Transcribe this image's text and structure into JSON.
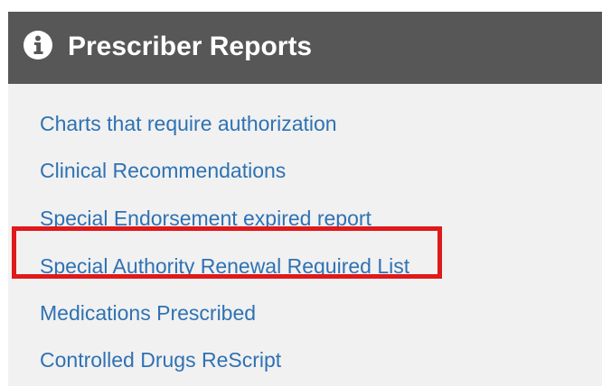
{
  "panel": {
    "title": "Prescriber Reports",
    "header_icon": "info-circle-icon",
    "header_bg": "#575757",
    "body_bg": "#f1f1f1",
    "link_color": "#2f72b3",
    "highlight_color": "#e0191b"
  },
  "reports": [
    {
      "label": "Charts that require authorization"
    },
    {
      "label": "Clinical Recommendations"
    },
    {
      "label": "Special Endorsement expired report"
    },
    {
      "label": "Special Authority Renewal Required List",
      "highlighted": true
    },
    {
      "label": "Medications Prescribed"
    },
    {
      "label": "Controlled Drugs ReScript"
    }
  ]
}
